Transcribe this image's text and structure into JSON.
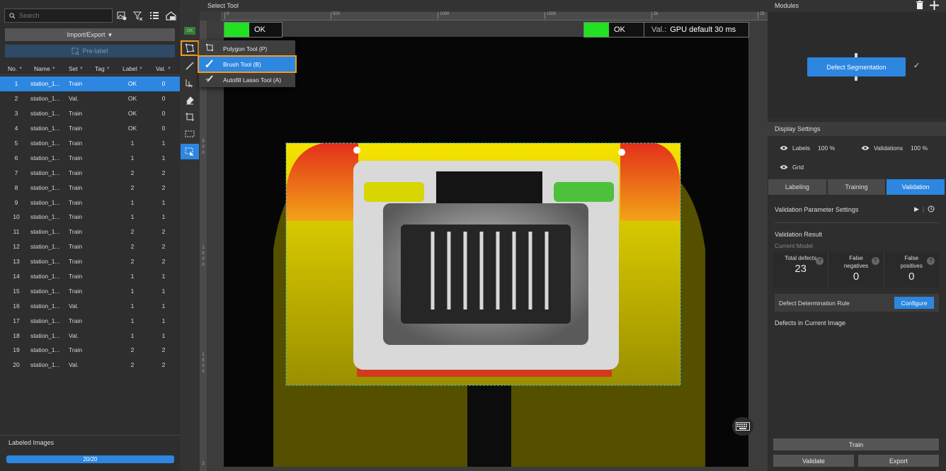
{
  "search": {
    "placeholder": "Search"
  },
  "left_toolbar_icons": [
    "image-settings-icon",
    "filter-icon",
    "list-icon",
    "home-icon"
  ],
  "import_export": {
    "label": "Import/Export"
  },
  "prelabel": {
    "label": "Pre-label"
  },
  "table": {
    "columns": [
      "No.",
      "Name",
      "Set",
      "Tag",
      "Label",
      "Val."
    ],
    "rows": [
      [
        "1",
        "station_1...",
        "Train",
        "",
        "OK",
        "0"
      ],
      [
        "2",
        "station_1...",
        "Val.",
        "",
        "OK",
        "0"
      ],
      [
        "3",
        "station_1...",
        "Train",
        "",
        "OK",
        "0"
      ],
      [
        "4",
        "station_1...",
        "Train",
        "",
        "OK",
        "0"
      ],
      [
        "5",
        "station_1...",
        "Train",
        "",
        "1",
        "1"
      ],
      [
        "6",
        "station_1...",
        "Train",
        "",
        "1",
        "1"
      ],
      [
        "7",
        "station_1...",
        "Train",
        "",
        "2",
        "2"
      ],
      [
        "8",
        "station_1...",
        "Train",
        "",
        "2",
        "2"
      ],
      [
        "9",
        "station_1...",
        "Train",
        "",
        "1",
        "1"
      ],
      [
        "10",
        "station_1...",
        "Train",
        "",
        "1",
        "1"
      ],
      [
        "11",
        "station_1...",
        "Train",
        "",
        "2",
        "2"
      ],
      [
        "12",
        "station_1...",
        "Train",
        "",
        "2",
        "2"
      ],
      [
        "13",
        "station_1...",
        "Train",
        "",
        "2",
        "2"
      ],
      [
        "14",
        "station_1...",
        "Train",
        "",
        "1",
        "1"
      ],
      [
        "15",
        "station_1...",
        "Train",
        "",
        "1",
        "1"
      ],
      [
        "16",
        "station_1...",
        "Val.",
        "",
        "1",
        "1"
      ],
      [
        "17",
        "station_1...",
        "Train",
        "",
        "1",
        "1"
      ],
      [
        "18",
        "station_1...",
        "Val.",
        "",
        "1",
        "1"
      ],
      [
        "19",
        "station_1...",
        "Train",
        "",
        "2",
        "2"
      ],
      [
        "20",
        "station_1...",
        "Val.",
        "",
        "2",
        "2"
      ]
    ],
    "selected_row": 0
  },
  "labeled_images": {
    "label": "Labeled Images",
    "progress_text": "20/20",
    "progress": 1.0
  },
  "tool_strip": {
    "ok_badge": "OK"
  },
  "canvas": {
    "title": "Select Tool",
    "ruler_ticks": [
      "0",
      "500",
      "1000",
      "1500",
      "2k",
      "25"
    ],
    "vruler_labels": [
      "5",
      "0",
      "0",
      "1",
      "0",
      "0",
      "0",
      "1",
      "5",
      "0",
      "0",
      "2"
    ],
    "left_result": "OK",
    "right_result": "OK",
    "val_label": "Val.:",
    "val_text": "GPU default 30 ms"
  },
  "tool_popup": {
    "items": [
      {
        "label": "Polygon Tool (P)",
        "icon": "polygon-icon"
      },
      {
        "label": "Brush Tool (B)",
        "icon": "brush-icon"
      },
      {
        "label": "Autofill Lasso Tool (A)",
        "icon": "lasso-icon"
      }
    ],
    "highlighted": 1
  },
  "right_panel": {
    "modules_title": "Modules",
    "module_name": "Defect Segmentation",
    "display_settings": "Display Settings",
    "labels": "Labels",
    "labels_pct": "100 %",
    "validations": "Validations",
    "validations_pct": "100 %",
    "grid": "Grid",
    "tabs": [
      "Labeling",
      "Training",
      "Validation"
    ],
    "active_tab": 2,
    "vps": "Validation Parameter Settings",
    "validation_result": "Validation Result",
    "current_model": "Current Model",
    "stats": [
      {
        "label": "Total defects",
        "value": "23"
      },
      {
        "label": "False negatives",
        "value": "0"
      },
      {
        "label": "False positives",
        "value": "0"
      }
    ],
    "ddr": "Defect Determination Rule",
    "configure": "Configure",
    "defects_current": "Defects in Current Image",
    "train": "Train",
    "validate": "Validate",
    "export": "Export"
  },
  "colors": {
    "accent": "#2d86e0",
    "highlight": "#f29a23",
    "ok_green": "#22e022"
  }
}
